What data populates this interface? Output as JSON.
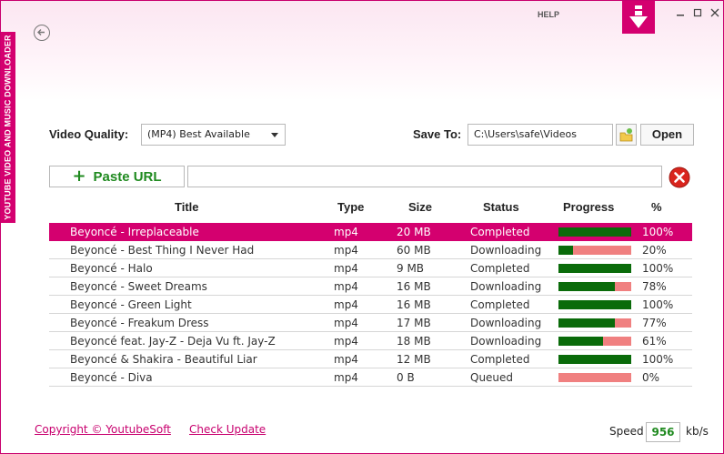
{
  "app": {
    "side_title": "YOUTUBE VIDEO AND MUSIC DOWNLOADER",
    "help_label": "HELP",
    "logo_icon": "download-arrow-icon"
  },
  "settings": {
    "quality_label": "Video Quality:",
    "quality_value": "(MP4) Best Available",
    "save_to_label": "Save To:",
    "save_to_path": "C:\\Users\\safe\\Videos",
    "open_label": "Open"
  },
  "url_bar": {
    "paste_label": "Paste URL",
    "url_value": ""
  },
  "table": {
    "headers": {
      "title": "Title",
      "type": "Type",
      "size": "Size",
      "status": "Status",
      "progress": "Progress",
      "percent": "%"
    },
    "rows": [
      {
        "title": "Beyoncé - Irreplaceable",
        "type": "mp4",
        "size": "20 MB",
        "status": "Completed",
        "progress": 100,
        "percent": "100%"
      },
      {
        "title": "Beyoncé - Best Thing I Never Had",
        "type": "mp4",
        "size": "60 MB",
        "status": "Downloading",
        "progress": 20,
        "percent": "20%"
      },
      {
        "title": "Beyoncé - Halo",
        "type": "mp4",
        "size": "9 MB",
        "status": "Completed",
        "progress": 100,
        "percent": "100%"
      },
      {
        "title": "Beyoncé - Sweet Dreams",
        "type": "mp4",
        "size": "16 MB",
        "status": "Downloading",
        "progress": 78,
        "percent": "78%"
      },
      {
        "title": "Beyoncé - Green Light",
        "type": "mp4",
        "size": "16 MB",
        "status": "Completed",
        "progress": 100,
        "percent": "100%"
      },
      {
        "title": "Beyoncé - Freakum Dress",
        "type": "mp4",
        "size": "17 MB",
        "status": "Downloading",
        "progress": 77,
        "percent": "77%"
      },
      {
        "title": "Beyoncé feat. Jay-Z - Deja Vu ft. Jay-Z",
        "type": "mp4",
        "size": "18 MB",
        "status": "Downloading",
        "progress": 61,
        "percent": "61%"
      },
      {
        "title": "Beyoncé & Shakira - Beautiful Liar",
        "type": "mp4",
        "size": "12 MB",
        "status": "Completed",
        "progress": 100,
        "percent": "100%"
      },
      {
        "title": "Beyoncé - Diva",
        "type": "mp4",
        "size": "0 B",
        "status": "Queued",
        "progress": 0,
        "percent": "0%"
      }
    ]
  },
  "footer": {
    "copyright": "Copyright © YoutubeSoft",
    "check_update": "Check Update",
    "speed_label": "Speed",
    "speed_value": "956",
    "speed_unit": "kb/s"
  },
  "colors": {
    "accent": "#d4006f",
    "progress_done": "#0a6b0a",
    "progress_remaining": "#f08080",
    "paste_green": "#1f8a1f"
  }
}
